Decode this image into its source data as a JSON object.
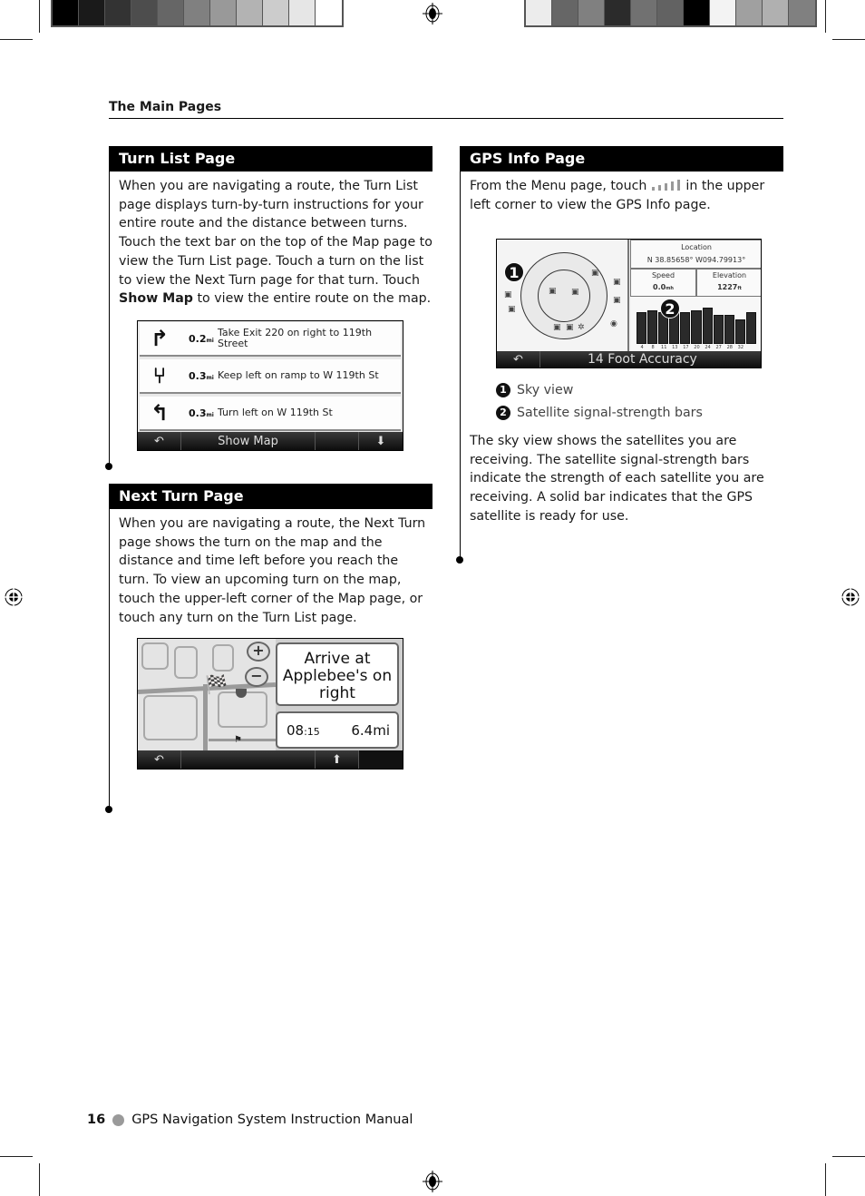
{
  "print_marks": {
    "left_swatches": [
      "#000000",
      "#1a1a1a",
      "#333333",
      "#4d4d4d",
      "#666666",
      "#808080",
      "#999999",
      "#b3b3b3",
      "#cccccc",
      "#e6e6e6",
      "#ffffff"
    ],
    "right_swatches": [
      "#ececec",
      "#666666",
      "#808080",
      "#2b2b2b",
      "#717171",
      "#626262",
      "#000000",
      "#f3f3f3",
      "#a0a0a0",
      "#b0b0b0",
      "#808080"
    ]
  },
  "running_head": "The Main Pages",
  "turn_list": {
    "heading": "Turn List Page",
    "body_parts": {
      "text": "When you are navigating a route, the Turn List page displays turn-by-turn instructions for your entire route and the distance between turns. Touch the text bar on the top of the Map page to view the Turn List page. Touch a turn on the list to view the Next Turn page for that turn. Touch ",
      "bold": "Show Map",
      "tail": " to view the entire route on the map."
    },
    "screen": {
      "rows": [
        {
          "icon": "exit-right-icon",
          "distance": "0.2",
          "unit": "mi",
          "instruction": "Take Exit 220 on right to 119th Street"
        },
        {
          "icon": "keep-left-icon",
          "distance": "0.3",
          "unit": "mi",
          "instruction": "Keep left on ramp to W 119th St"
        },
        {
          "icon": "turn-left-icon",
          "distance": "0.3",
          "unit": "mi",
          "instruction": "Turn left on W 119th St"
        }
      ],
      "back_icon": "↶",
      "show_map_label": "Show Map",
      "scroll_down_icon": "⬇"
    }
  },
  "next_turn": {
    "heading": "Next Turn Page",
    "body": "When you are navigating a route, the Next Turn page shows the turn on the map and the distance and time left before you reach the turn. To view an upcoming turn on the map, touch the upper-left corner of the Map page, or touch any turn on the Turn List page.",
    "screen": {
      "zoom_in": "+",
      "zoom_out": "−",
      "message": "Arrive at Applebee's on right",
      "time": "08",
      "time_minutes": ":15",
      "distance": "6.4mi",
      "back_icon": "↶",
      "up_icon": "⬆"
    }
  },
  "gps_info": {
    "heading": "GPS Info Page",
    "body_before_icon": "From the Menu page, touch ",
    "body_after_icon": " in the upper left corner to view the GPS Info page.",
    "screen": {
      "location_label": "Location",
      "location_value": "N 38.85658° W094.79913°",
      "speed_label": "Speed",
      "speed_value": "0.0",
      "speed_unit": "mh",
      "elevation_label": "Elevation",
      "elevation_value": "1227",
      "elevation_unit": "ft",
      "accuracy": "14 Foot Accuracy",
      "back_icon": "↶",
      "callout_1": "1",
      "callout_2": "2",
      "signal_bars": [
        {
          "sat": "4",
          "strength": 0.72
        },
        {
          "sat": "8",
          "strength": 0.78
        },
        {
          "sat": "11",
          "strength": 0.72
        },
        {
          "sat": "13",
          "strength": 0.8
        },
        {
          "sat": "17",
          "strength": 0.72
        },
        {
          "sat": "20",
          "strength": 0.78
        },
        {
          "sat": "24",
          "strength": 0.84
        },
        {
          "sat": "27",
          "strength": 0.66
        },
        {
          "sat": "28",
          "strength": 0.66
        },
        {
          "sat": "32",
          "strength": 0.56
        },
        {
          "sat": "",
          "strength": 0.72
        }
      ]
    },
    "legend": [
      {
        "num": "1",
        "label": "Sky view"
      },
      {
        "num": "2",
        "label": "Satellite signal-strength bars"
      }
    ],
    "body2": "The sky view shows the satellites you are receiving. The satellite signal-strength bars indicate the strength of each satellite you are receiving. A solid bar indicates that the GPS satellite is ready for use."
  },
  "footer": {
    "page_number": "16",
    "title": "GPS Navigation System Instruction Manual"
  }
}
